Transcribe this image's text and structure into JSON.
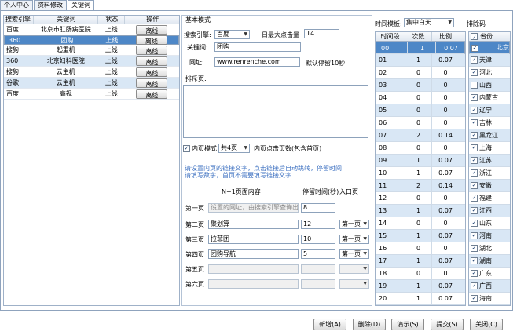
{
  "tabs": [
    "个人中心",
    "资料修改",
    "关键词"
  ],
  "left_table": {
    "headers": [
      "搜索引擎",
      "关键词",
      "状态",
      "操作"
    ],
    "rows": [
      {
        "engine": "百度",
        "keyword": "北京市肛肠病医院",
        "status": "上线",
        "action": "离线"
      },
      {
        "engine": "360",
        "keyword": "团购",
        "status": "上线",
        "action": "离线"
      },
      {
        "engine": "搜狗",
        "keyword": "起重机",
        "status": "上线",
        "action": "离线"
      },
      {
        "engine": "360",
        "keyword": "北京妇科医院",
        "status": "上线",
        "action": "离线"
      },
      {
        "engine": "搜狗",
        "keyword": "云主机",
        "status": "上线",
        "action": "离线"
      },
      {
        "engine": "谷歌",
        "keyword": "云主机",
        "status": "上线",
        "action": "离线"
      },
      {
        "engine": "百度",
        "keyword": "高视",
        "status": "上线",
        "action": "离线"
      }
    ]
  },
  "form": {
    "section_title": "基本模式",
    "engine_label": "搜索引擎:",
    "engine_value": "百度",
    "max_clicks_label": "日最大点击量",
    "max_clicks_value": "14",
    "keyword_label": "关键词:",
    "keyword_value": "团购",
    "url_label": "网址:",
    "url_value": "www.renrenche.com",
    "default_stay": "默认停留10秒",
    "exclude_label": "排斥页:",
    "inner_mode_label": "内页模式",
    "inner_pages_value": "共4页",
    "inner_pages_note": "内页点击页数(包含首页)",
    "note": "请设置内页的链接文字，点击链接后自动跳转，停留时间请填写数字，首页不需要填写链接文字",
    "col_text": "N+1页面内容",
    "col_stay": "停留时间(秒)",
    "col_entry": "入口页",
    "pages": [
      {
        "label": "第一页",
        "text": "设置的网址，由搜索引擎查询出",
        "stay": "8",
        "entry": ""
      },
      {
        "label": "第二页",
        "text": "聚划算",
        "stay": "12",
        "entry": "第一页"
      },
      {
        "label": "第三页",
        "text": "拉菲团",
        "stay": "10",
        "entry": "第一页"
      },
      {
        "label": "第四页",
        "text": "团购导航",
        "stay": "5",
        "entry": "第一页"
      },
      {
        "label": "第五页",
        "text": "",
        "stay": "",
        "entry": ""
      },
      {
        "label": "第六页",
        "text": "",
        "stay": "",
        "entry": ""
      }
    ]
  },
  "time_panel": {
    "template_label": "时间模板:",
    "template_value": "集中白天",
    "exclude_label": "排除码",
    "headers": [
      "时间段",
      "次数",
      "比例"
    ],
    "rows": [
      {
        "slot": "00",
        "count": "1",
        "ratio": "0.07"
      },
      {
        "slot": "01",
        "count": "1",
        "ratio": "0.07"
      },
      {
        "slot": "02",
        "count": "0",
        "ratio": "0"
      },
      {
        "slot": "03",
        "count": "0",
        "ratio": "0"
      },
      {
        "slot": "04",
        "count": "0",
        "ratio": "0"
      },
      {
        "slot": "05",
        "count": "0",
        "ratio": "0"
      },
      {
        "slot": "06",
        "count": "0",
        "ratio": "0"
      },
      {
        "slot": "07",
        "count": "2",
        "ratio": "0.14"
      },
      {
        "slot": "08",
        "count": "0",
        "ratio": "0"
      },
      {
        "slot": "09",
        "count": "1",
        "ratio": "0.07"
      },
      {
        "slot": "10",
        "count": "1",
        "ratio": "0.07"
      },
      {
        "slot": "11",
        "count": "2",
        "ratio": "0.14"
      },
      {
        "slot": "12",
        "count": "0",
        "ratio": "0"
      },
      {
        "slot": "13",
        "count": "1",
        "ratio": "0.07"
      },
      {
        "slot": "14",
        "count": "0",
        "ratio": "0"
      },
      {
        "slot": "15",
        "count": "1",
        "ratio": "0.07"
      },
      {
        "slot": "16",
        "count": "0",
        "ratio": "0"
      },
      {
        "slot": "17",
        "count": "1",
        "ratio": "0.07"
      },
      {
        "slot": "18",
        "count": "0",
        "ratio": "0"
      },
      {
        "slot": "19",
        "count": "1",
        "ratio": "0.07"
      },
      {
        "slot": "20",
        "count": "1",
        "ratio": "0.07"
      }
    ]
  },
  "provinces": {
    "header": "省份",
    "items": [
      {
        "name": "北京",
        "checked": true
      },
      {
        "name": "天津",
        "checked": true
      },
      {
        "name": "河北",
        "checked": true
      },
      {
        "name": "山西",
        "checked": false
      },
      {
        "name": "内蒙古",
        "checked": true
      },
      {
        "name": "辽宁",
        "checked": true
      },
      {
        "name": "吉林",
        "checked": true
      },
      {
        "name": "黑龙江",
        "checked": true
      },
      {
        "name": "上海",
        "checked": true
      },
      {
        "name": "江苏",
        "checked": true
      },
      {
        "name": "浙江",
        "checked": true
      },
      {
        "name": "安徽",
        "checked": true
      },
      {
        "name": "福建",
        "checked": true
      },
      {
        "name": "江西",
        "checked": true
      },
      {
        "name": "山东",
        "checked": true
      },
      {
        "name": "河南",
        "checked": true
      },
      {
        "name": "湖北",
        "checked": true
      },
      {
        "name": "湖南",
        "checked": true
      },
      {
        "name": "广东",
        "checked": true
      },
      {
        "name": "广西",
        "checked": true
      },
      {
        "name": "海南",
        "checked": true
      }
    ]
  },
  "buttons": {
    "add": "新增(A)",
    "delete": "删除(D)",
    "demo": "演示(S)",
    "submit": "提交(S)",
    "close": "关闭(C)"
  },
  "check_mark": "✓"
}
